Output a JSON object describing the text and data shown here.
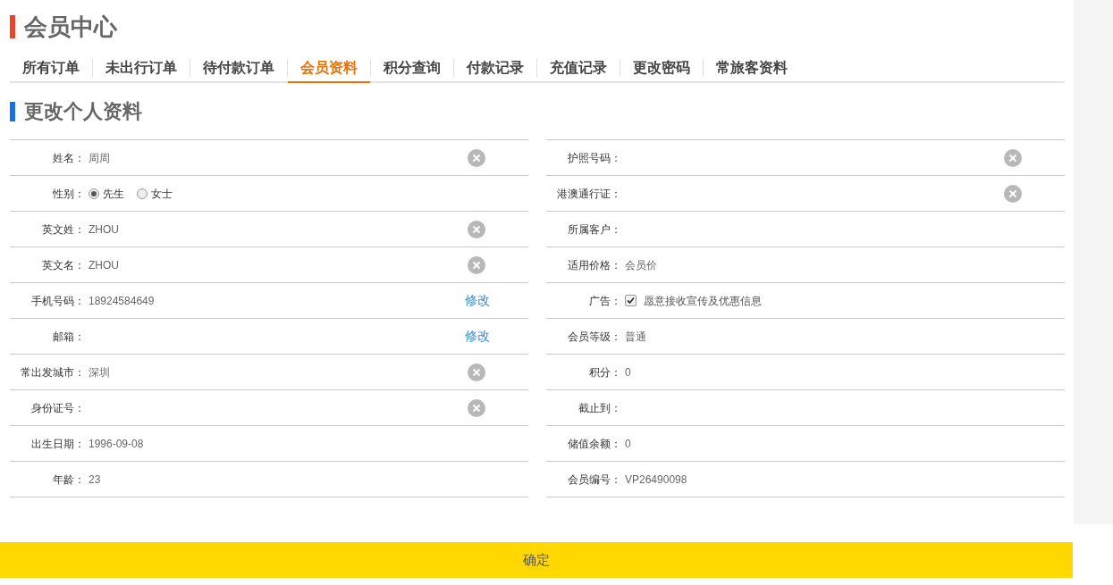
{
  "header": {
    "title": "会员中心"
  },
  "tabs": [
    {
      "label": "所有订单",
      "selected": false
    },
    {
      "label": "未出行订单",
      "selected": false
    },
    {
      "label": "待付款订单",
      "selected": false
    },
    {
      "label": "会员资料",
      "selected": true
    },
    {
      "label": "积分查询",
      "selected": false
    },
    {
      "label": "付款记录",
      "selected": false
    },
    {
      "label": "充值记录",
      "selected": false
    },
    {
      "label": "更改密码",
      "selected": false
    },
    {
      "label": "常旅客资料",
      "selected": false
    }
  ],
  "section": {
    "title": "更改个人资料"
  },
  "left_fields": [
    {
      "kind": "text",
      "label": "姓名：",
      "value": "周周",
      "clearable": true
    },
    {
      "kind": "radio",
      "label": "性别：",
      "options": [
        {
          "label": "先生",
          "selected": true
        },
        {
          "label": "女士",
          "selected": false
        }
      ]
    },
    {
      "kind": "text",
      "label": "英文姓：",
      "value": "ZHOU",
      "clearable": true
    },
    {
      "kind": "text",
      "label": "英文名：",
      "value": "ZHOU",
      "clearable": true
    },
    {
      "kind": "text",
      "label": "手机号码：",
      "value": "18924584649",
      "action": "修改"
    },
    {
      "kind": "text",
      "label": "邮箱：",
      "action": "修改"
    },
    {
      "kind": "text",
      "label": "常出发城市：",
      "value": "深圳",
      "clearable": true
    },
    {
      "kind": "text",
      "label": "身份证号：",
      "clearable": true
    },
    {
      "kind": "text",
      "label": "出生日期：",
      "value": "1996-09-08"
    },
    {
      "kind": "text",
      "label": "年龄：",
      "value": "23"
    }
  ],
  "right_fields": [
    {
      "kind": "text",
      "label": "护照号码：",
      "clearable": true
    },
    {
      "kind": "text",
      "label": "港澳通行证：",
      "clearable": true
    },
    {
      "kind": "text",
      "label": "所属客户："
    },
    {
      "kind": "text",
      "label": "适用价格：",
      "value": "会员价"
    },
    {
      "kind": "checkbox",
      "label": "广告：",
      "checked": true,
      "text": "愿意接收宣传及优惠信息"
    },
    {
      "kind": "text",
      "label": "会员等级：",
      "value": "普通"
    },
    {
      "kind": "text",
      "label": "积分：",
      "value": "0"
    },
    {
      "kind": "text",
      "label": "截止到："
    },
    {
      "kind": "text",
      "label": "储值余额：",
      "value": "0"
    },
    {
      "kind": "text",
      "label": "会员编号：",
      "value": "VP26490098"
    }
  ],
  "submit": {
    "label": "确定"
  }
}
